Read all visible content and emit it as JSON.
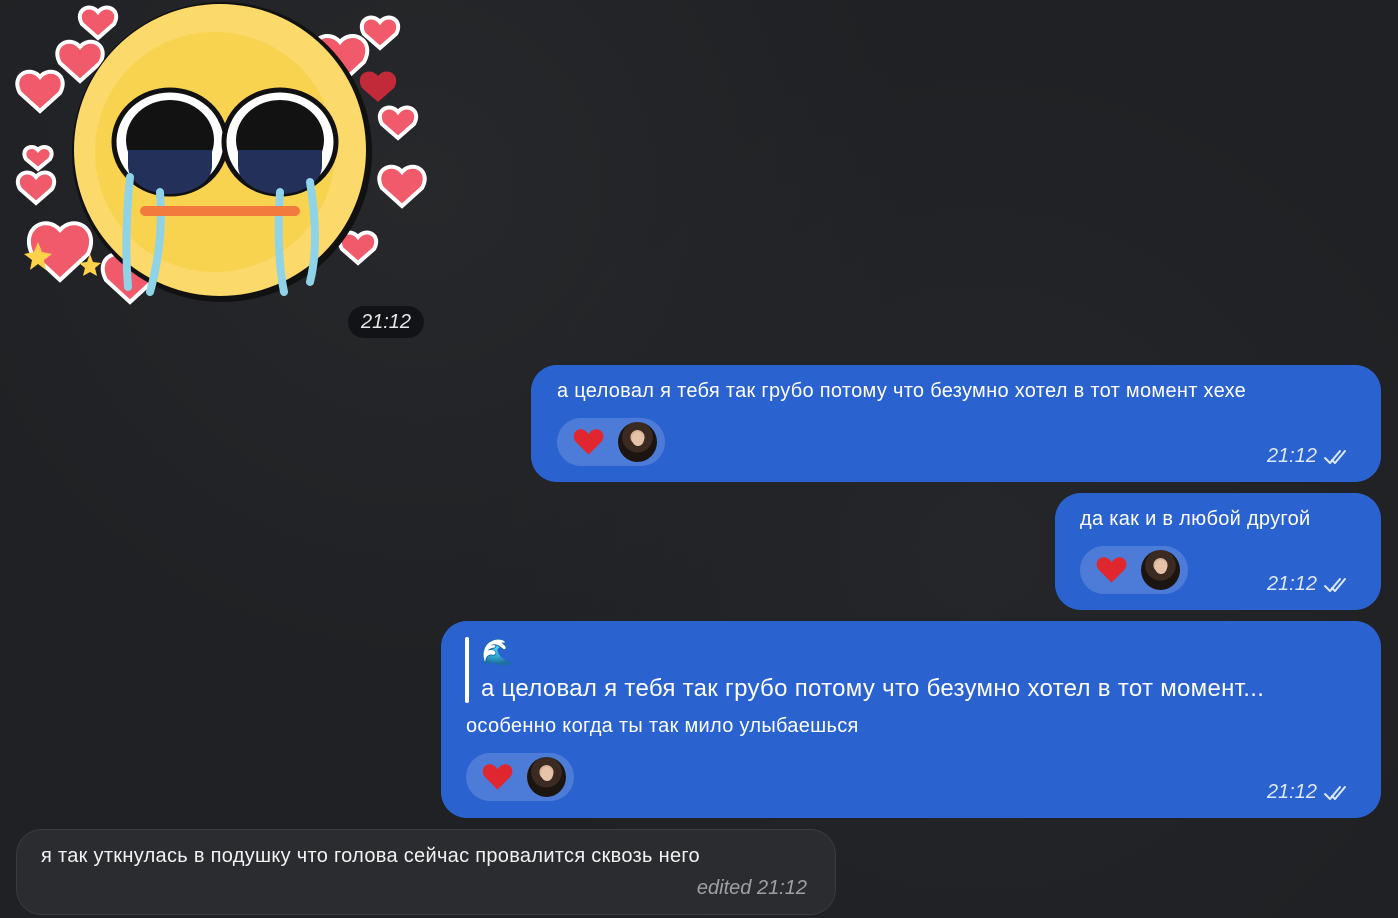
{
  "sticker": {
    "time": "21:12",
    "icon": "crying-face-with-hearts-sticker"
  },
  "messages": [
    {
      "text": "а целовал я тебя так грубо потому что безумно хотел в тот момент хехе",
      "reaction_icon": "heart-icon",
      "time": "21:12",
      "status_icon": "double-check-icon"
    },
    {
      "text": "да как и в любой другой",
      "reaction_icon": "heart-icon",
      "time": "21:12",
      "status_icon": "double-check-icon"
    },
    {
      "reply": {
        "title": "🌊",
        "text": "а целовал я тебя так грубо потому что безумно хотел в тот момент..."
      },
      "text": "особенно когда ты так мило улыбаешься",
      "reaction_icon": "heart-icon",
      "time": "21:12",
      "status_icon": "double-check-icon"
    },
    {
      "text": "я так уткнулась в подушку что голова сейчас провалится сквозь него",
      "meta": "edited 21:12"
    }
  ],
  "colors": {
    "background": "#1f2124",
    "outgoing_bubble": "#2a63d0",
    "incoming_bubble": "#2b2c30",
    "heart": "#e0262f"
  }
}
